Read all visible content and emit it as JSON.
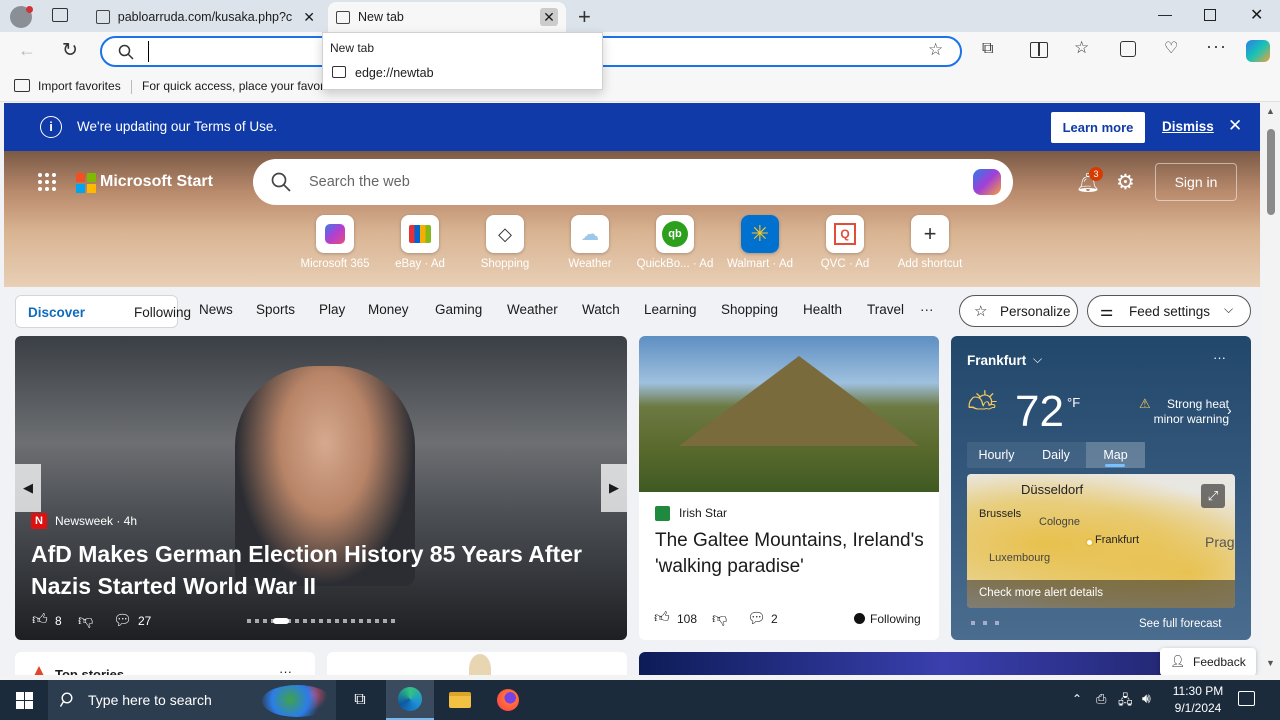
{
  "browser": {
    "tabs": [
      {
        "title": "pabloarruda.com/kusaka.php?ca",
        "active": false
      },
      {
        "title": "New tab",
        "active": true
      }
    ],
    "address_value": "",
    "dropdown": {
      "header": "New tab",
      "suggestion": "edge://newtab"
    },
    "favorites_bar": {
      "import_label": "Import favorites",
      "hint": "For quick access, place your favori"
    }
  },
  "banner": {
    "text": "We're updating our Terms of Use.",
    "learn_more": "Learn more",
    "dismiss": "Dismiss"
  },
  "header": {
    "brand": "Microsoft Start",
    "search_placeholder": "Search the web",
    "notif_count": "3",
    "sign_in": "Sign in"
  },
  "quicklinks": [
    {
      "label": "Microsoft 365",
      "icon": "microsoft365-icon"
    },
    {
      "label": "eBay · Ad",
      "icon": "ebay-icon"
    },
    {
      "label": "Shopping",
      "icon": "shopping-tag-icon"
    },
    {
      "label": "Weather",
      "icon": "weather-icon"
    },
    {
      "label": "QuickBo... · Ad",
      "icon": "quickbooks-icon"
    },
    {
      "label": "Walmart · Ad",
      "icon": "walmart-icon"
    },
    {
      "label": "QVC · Ad",
      "icon": "qvc-icon"
    },
    {
      "label": "Add shortcut",
      "icon": "plus-icon"
    }
  ],
  "nav": {
    "discover": "Discover",
    "following": "Following",
    "items": [
      "News",
      "Sports",
      "Play",
      "Money",
      "Gaming",
      "Weather",
      "Watch",
      "Learning",
      "Shopping",
      "Health",
      "Travel"
    ],
    "more": "···",
    "personalize": "Personalize",
    "feed_settings": "Feed settings"
  },
  "main_story": {
    "source": "Newsweek · 4h",
    "headline": "AfD Makes German Election History 85 Years After Nazis Started World War II",
    "likes": "8",
    "comments": "27"
  },
  "side_story": {
    "source": "Irish Star",
    "headline": "The Galtee Mountains, Ireland's 'walking paradise'",
    "likes": "108",
    "comments": "2",
    "following": "Following"
  },
  "weather": {
    "city": "Frankfurt",
    "temp": "72",
    "unit": "°F",
    "alert": "Strong heat minor warning",
    "tabs": [
      "Hourly",
      "Daily",
      "Map"
    ],
    "active_tab": "Map",
    "map_labels": [
      "Düsseldorf",
      "Brussels",
      "Cologne",
      "Frankfurt",
      "Luxembourg",
      "Prag"
    ],
    "alert_link": "Check more alert details",
    "full_forecast": "See full forecast"
  },
  "bottom": {
    "top_stories": "Top stories",
    "feedback": "Feedback"
  },
  "taskbar": {
    "search_placeholder": "Type here to search",
    "time": "11:30 PM",
    "date": "9/1/2024"
  },
  "colors": {
    "accent": "#0f6cbd",
    "banner": "#0f3aa8",
    "taskbar": "#1c2b3c"
  }
}
